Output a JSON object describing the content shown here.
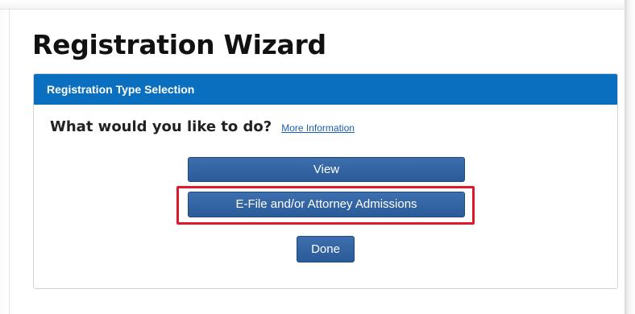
{
  "page": {
    "title": "Registration Wizard"
  },
  "panel": {
    "header": "Registration Type Selection",
    "question": "What would you like to do?",
    "more_info_link": "More Information"
  },
  "buttons": {
    "view": "View",
    "efile": "E-File and/or Attorney Admissions",
    "done": "Done"
  },
  "colors": {
    "header_blue": "#0a6fbf",
    "button_blue": "#2f5f9e",
    "highlight_red": "#e3162a"
  }
}
